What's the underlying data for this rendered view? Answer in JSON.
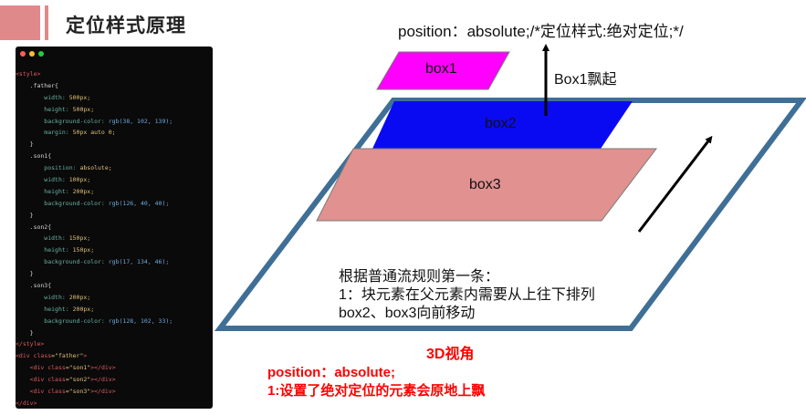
{
  "header": {
    "title": "定位样式原理"
  },
  "code": {
    "lines": [
      [
        {
          "t": "<style>",
          "c": "c-tag"
        }
      ],
      [
        {
          "t": "    .father{",
          "c": "c-sel"
        }
      ],
      [
        {
          "t": "        width: ",
          "c": "c-prop"
        },
        {
          "t": "500px;",
          "c": "c-val"
        }
      ],
      [
        {
          "t": "        height: ",
          "c": "c-prop"
        },
        {
          "t": "500px;",
          "c": "c-val"
        }
      ],
      [
        {
          "t": "        background-color: ",
          "c": "c-prop"
        },
        {
          "t": "rgb(38, 102, 139);",
          "c": "c-fn"
        }
      ],
      [
        {
          "t": "        margin: ",
          "c": "c-prop"
        },
        {
          "t": "50px auto 0;",
          "c": "c-val"
        }
      ],
      [
        {
          "t": "    }",
          "c": "c-sel"
        }
      ],
      [
        {
          "t": "    .son1{",
          "c": "c-sel"
        }
      ],
      [
        {
          "t": "        position: ",
          "c": "c-prop"
        },
        {
          "t": "absolute;",
          "c": "c-val"
        }
      ],
      [
        {
          "t": "        width: ",
          "c": "c-prop"
        },
        {
          "t": "100px;",
          "c": "c-val"
        }
      ],
      [
        {
          "t": "        height: ",
          "c": "c-prop"
        },
        {
          "t": "200px;",
          "c": "c-val"
        }
      ],
      [
        {
          "t": "        background-color: ",
          "c": "c-prop"
        },
        {
          "t": "rgb(126, 40, 40);",
          "c": "c-fn"
        }
      ],
      [
        {
          "t": "    }",
          "c": "c-sel"
        }
      ],
      [
        {
          "t": "    .son2{",
          "c": "c-sel"
        }
      ],
      [
        {
          "t": "        width: ",
          "c": "c-prop"
        },
        {
          "t": "150px;",
          "c": "c-val"
        }
      ],
      [
        {
          "t": "        height: ",
          "c": "c-prop"
        },
        {
          "t": "150px;",
          "c": "c-val"
        }
      ],
      [
        {
          "t": "        background-color: ",
          "c": "c-prop"
        },
        {
          "t": "rgb(17, 134, 46);",
          "c": "c-fn"
        }
      ],
      [
        {
          "t": "    }",
          "c": "c-sel"
        }
      ],
      [
        {
          "t": "    .son3{",
          "c": "c-sel"
        }
      ],
      [
        {
          "t": "        width: ",
          "c": "c-prop"
        },
        {
          "t": "200px;",
          "c": "c-val"
        }
      ],
      [
        {
          "t": "        height: ",
          "c": "c-prop"
        },
        {
          "t": "200px;",
          "c": "c-val"
        }
      ],
      [
        {
          "t": "        background-color: ",
          "c": "c-prop"
        },
        {
          "t": "rgb(128, 102, 33);",
          "c": "c-fn"
        }
      ],
      [
        {
          "t": "    }",
          "c": "c-sel"
        }
      ],
      [
        {
          "t": "</style>",
          "c": "c-tag"
        }
      ],
      [
        {
          "t": "<div ",
          "c": "c-tag"
        },
        {
          "t": "class",
          "c": "c-attr"
        },
        {
          "t": "=\"father\"",
          "c": "c-str"
        },
        {
          "t": ">",
          "c": "c-tag"
        }
      ],
      [
        {
          "t": "    <div ",
          "c": "c-tag"
        },
        {
          "t": "class",
          "c": "c-attr"
        },
        {
          "t": "=\"son1\"",
          "c": "c-str"
        },
        {
          "t": "></div>",
          "c": "c-tag"
        }
      ],
      [
        {
          "t": "    <div ",
          "c": "c-tag"
        },
        {
          "t": "class",
          "c": "c-attr"
        },
        {
          "t": "=\"son2\"",
          "c": "c-str"
        },
        {
          "t": "></div>",
          "c": "c-tag"
        }
      ],
      [
        {
          "t": "    <div ",
          "c": "c-tag"
        },
        {
          "t": "class",
          "c": "c-attr"
        },
        {
          "t": "=\"son3\"",
          "c": "c-str"
        },
        {
          "t": "></div>",
          "c": "c-tag"
        }
      ],
      [
        {
          "t": "</div>",
          "c": "c-tag"
        }
      ]
    ]
  },
  "diagram": {
    "position_label": "position：absolute;/*定位样式:绝对定位;*/",
    "box1_label": "box1",
    "box2_label": "box2",
    "box3_label": "box3",
    "float_label": "Box1飘起",
    "rule_lines": [
      "根据普通流规则第一条：",
      "1：块元素在父元素内需要从上往下排列",
      "box2、box3向前移动"
    ],
    "view_label": "3D视角"
  },
  "notes": {
    "line1": "position：absolute;",
    "line2": "1:设置了绝对定位的元素会原地上飘"
  },
  "colors": {
    "accent": "#e0898a",
    "father_border": "#3f6f96",
    "box1": "#ff00ff",
    "box2": "#0a0af2",
    "box3": "#e09190",
    "red_text": "#ff0000",
    "dot_red": "#ff5f56",
    "dot_yellow": "#ffbd2e",
    "dot_green": "#27c93f"
  }
}
